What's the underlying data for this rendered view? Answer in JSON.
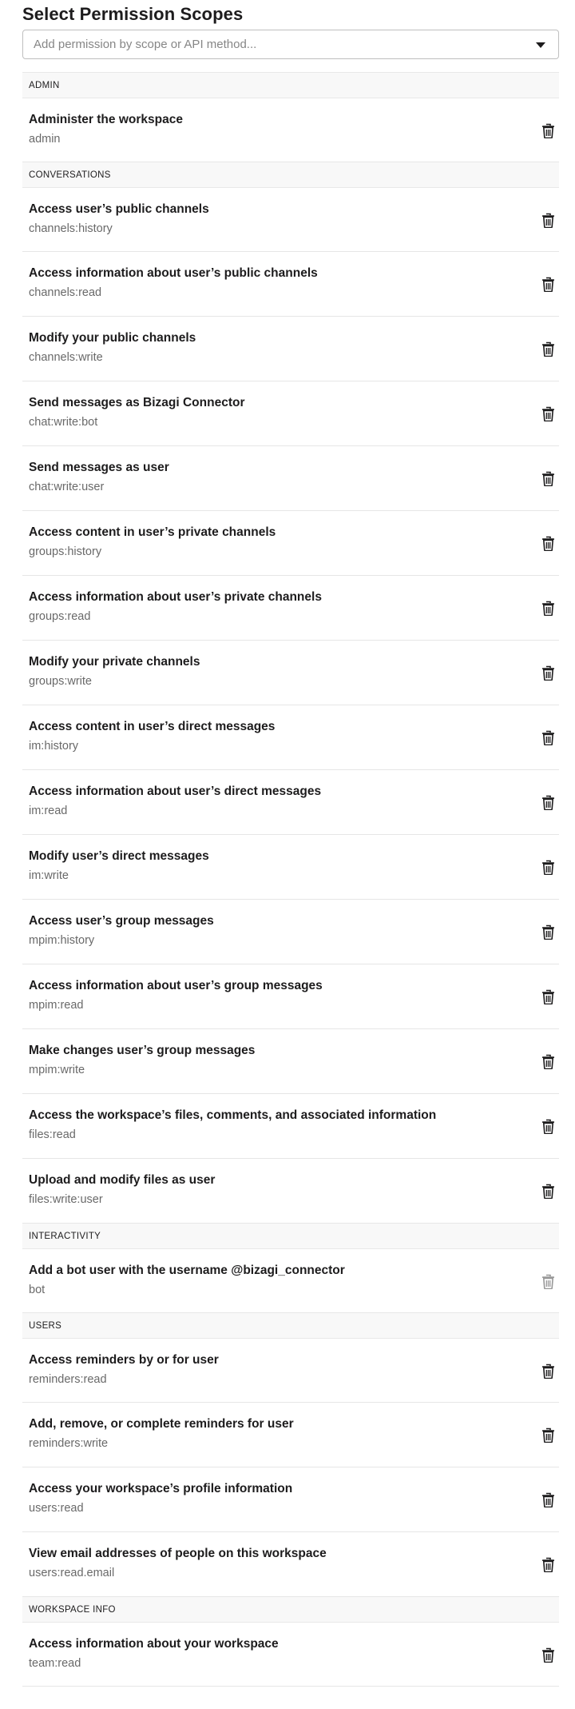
{
  "page": {
    "title": "Select Permission Scopes",
    "search_placeholder": "Add permission by scope or API method..."
  },
  "sections": [
    {
      "header": "ADMIN",
      "scopes": [
        {
          "title": "Administer the workspace",
          "code": "admin"
        }
      ]
    },
    {
      "header": "CONVERSATIONS",
      "scopes": [
        {
          "title": "Access user’s public channels",
          "code": "channels:history"
        },
        {
          "title": "Access information about user’s public channels",
          "code": "channels:read"
        },
        {
          "title": "Modify your public channels",
          "code": "channels:write"
        },
        {
          "title": "Send messages as Bizagi Connector",
          "code": "chat:write:bot"
        },
        {
          "title": "Send messages as user",
          "code": "chat:write:user"
        },
        {
          "title": "Access content in user’s private channels",
          "code": "groups:history"
        },
        {
          "title": "Access information about user’s private channels",
          "code": "groups:read"
        },
        {
          "title": "Modify your private channels",
          "code": "groups:write"
        },
        {
          "title": "Access content in user’s direct messages",
          "code": "im:history"
        },
        {
          "title": "Access information about user’s direct messages",
          "code": "im:read"
        },
        {
          "title": "Modify user’s direct messages",
          "code": "im:write"
        },
        {
          "title": "Access user’s group messages",
          "code": "mpim:history"
        },
        {
          "title": "Access information about user’s group messages",
          "code": "mpim:read"
        },
        {
          "title": "Make changes user’s group messages",
          "code": "mpim:write"
        },
        {
          "title": "Access the workspace’s files, comments, and associated information",
          "code": "files:read"
        },
        {
          "title": "Upload and modify files as user",
          "code": "files:write:user"
        }
      ]
    },
    {
      "header": "INTERACTIVITY",
      "scopes": [
        {
          "title": "Add a bot user with the username @bizagi_connector",
          "code": "bot",
          "disabled": true
        }
      ]
    },
    {
      "header": "USERS",
      "scopes": [
        {
          "title": "Access reminders by or for user",
          "code": "reminders:read"
        },
        {
          "title": "Add, remove, or complete reminders for user",
          "code": "reminders:write"
        },
        {
          "title": "Access your workspace’s profile information",
          "code": "users:read"
        },
        {
          "title": "View email addresses of people on this workspace",
          "code": "users:read.email"
        }
      ]
    },
    {
      "header": "WORKSPACE INFO",
      "scopes": [
        {
          "title": "Access information about your workspace",
          "code": "team:read"
        }
      ]
    }
  ],
  "icons": {
    "remove": "trash-icon",
    "dropdown": "chevron-down-icon"
  },
  "colors": {
    "section_bg": "#f8f8f8",
    "text": "#1d1c1d",
    "muted": "#696969"
  }
}
